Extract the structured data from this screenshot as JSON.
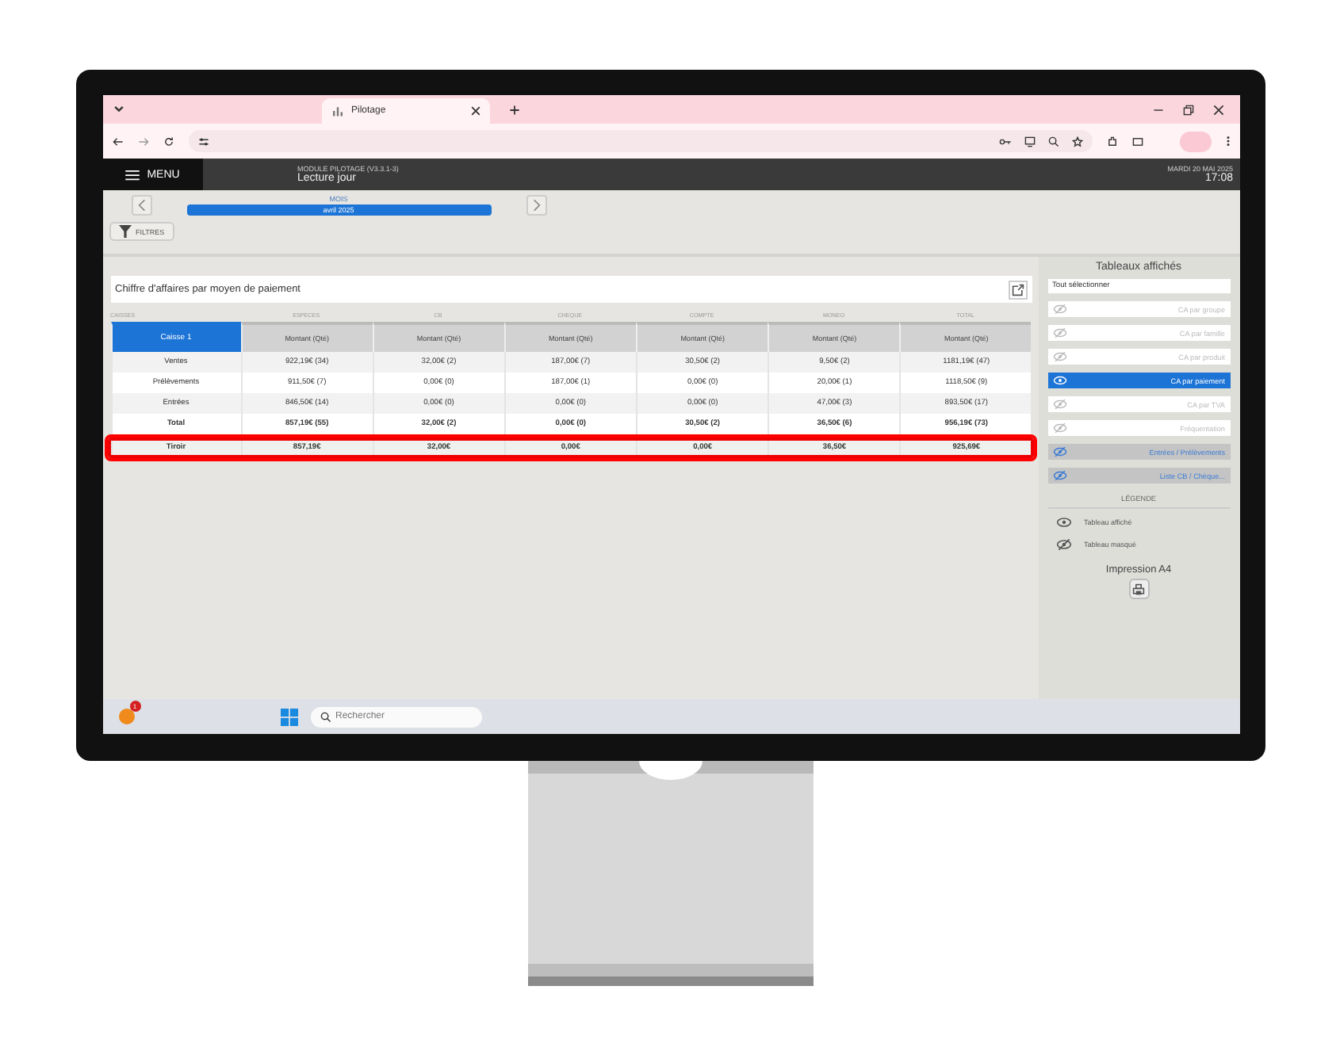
{
  "browser": {
    "tab_title": "Pilotage"
  },
  "app": {
    "menu": "MENU",
    "module": "MODULE PILOTAGE (V3.3.1-3)",
    "subtitle": "Lecture jour",
    "date": "MARDI 20 MAI 2025",
    "time": "17:08"
  },
  "period": {
    "label": "MOIS",
    "value": "avril 2025"
  },
  "filters_button": "FILTRES",
  "report": {
    "title": "Chiffre d'affaires par moyen de paiement",
    "groups": [
      "CAISSES",
      "ESPECES",
      "CB",
      "CHEQUE",
      "COMPTE",
      "MONEO",
      "TOTAL"
    ],
    "header": [
      "Caisse 1",
      "Montant (Qté)",
      "Montant (Qté)",
      "Montant (Qté)",
      "Montant (Qté)",
      "Montant (Qté)",
      "Montant (Qté)"
    ],
    "rows": [
      {
        "cells": [
          "Ventes",
          "922,19€ (34)",
          "32,00€ (2)",
          "187,00€ (7)",
          "30,50€ (2)",
          "9,50€ (2)",
          "1181,19€ (47)"
        ],
        "bold": false,
        "highlighted": false
      },
      {
        "cells": [
          "Prélèvements",
          "911,50€ (7)",
          "0,00€ (0)",
          "187,00€ (1)",
          "0,00€ (0)",
          "20,00€ (1)",
          "1118,50€ (9)"
        ],
        "bold": false,
        "highlighted": false
      },
      {
        "cells": [
          "Entrées",
          "846,50€ (14)",
          "0,00€ (0)",
          "0,00€ (0)",
          "0,00€ (0)",
          "47,00€ (3)",
          "893,50€ (17)"
        ],
        "bold": false,
        "highlighted": false
      },
      {
        "cells": [
          "Total",
          "857,19€ (55)",
          "32,00€ (2)",
          "0,00€ (0)",
          "30,50€ (2)",
          "36,50€ (6)",
          "956,19€ (73)"
        ],
        "bold": true,
        "highlighted": false
      },
      {
        "cells": [
          "Tiroir",
          "857,19€",
          "32,00€",
          "0,00€",
          "0,00€",
          "36,50€",
          "925,69€"
        ],
        "bold": true,
        "highlighted": true
      }
    ]
  },
  "sidebar": {
    "title": "Tableaux affichés",
    "select_all": "Tout sélectionner",
    "items": [
      {
        "label": "CA par groupe",
        "kind": "table",
        "selected": false
      },
      {
        "label": "CA par famille",
        "kind": "table",
        "selected": false
      },
      {
        "label": "CA par produit",
        "kind": "table",
        "selected": false
      },
      {
        "label": "CA par paiement",
        "kind": "table",
        "selected": true
      },
      {
        "label": "CA par TVA",
        "kind": "table",
        "selected": false
      },
      {
        "label": "Fréquentation",
        "kind": "table",
        "selected": false
      },
      {
        "label": "Entrées / Prélèvements",
        "kind": "list",
        "selected": false
      },
      {
        "label": "Liste CB / Chèque...",
        "kind": "list",
        "selected": false
      }
    ],
    "legend_title": "LÉGENDE",
    "legend": [
      "Tableau affiché",
      "Tableau masqué"
    ],
    "print_title": "Impression A4"
  },
  "taskbar": {
    "search_placeholder": "Rechercher",
    "badge": "1"
  }
}
